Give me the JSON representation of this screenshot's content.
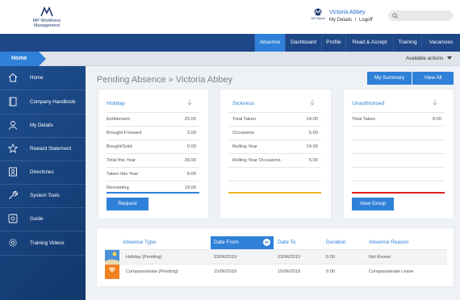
{
  "brand": {
    "logo_text_line1": "MP Workforce",
    "logo_text_line2": "Management",
    "user_logo_text": "MP Payroll"
  },
  "user": {
    "name": "Victoria Abbey",
    "my_details": "My Details",
    "separator": "/",
    "logoff": "Logoff"
  },
  "search": {
    "placeholder": ""
  },
  "nav": {
    "items": [
      "Absence",
      "Dashboard",
      "Profile",
      "Read & Accept",
      "Training",
      "Vacancies"
    ],
    "active": "Absence"
  },
  "subbar": {
    "home": "Home",
    "available_actions": "Available actions"
  },
  "sidebar": {
    "items": [
      {
        "label": "Home",
        "icon": "home-icon"
      },
      {
        "label": "Company Handbook",
        "icon": "book-icon"
      },
      {
        "label": "My Details",
        "icon": "user-icon"
      },
      {
        "label": "Reward Statement",
        "icon": "star-icon"
      },
      {
        "label": "Directories",
        "icon": "directory-icon"
      },
      {
        "label": "System Tools",
        "icon": "wrench-icon"
      },
      {
        "label": "Guide",
        "icon": "guide-icon"
      },
      {
        "label": "Training Videos",
        "icon": "gear-icon"
      }
    ]
  },
  "main": {
    "title": "Pending Absence » Victoria Abbey",
    "my_summary": "My Summary",
    "view_all": "View All"
  },
  "cards": {
    "holiday": {
      "title": "Holiday",
      "rows": [
        {
          "label": "Entitlement",
          "value": "25.00"
        },
        {
          "label": "Brought Forward",
          "value": "3.00"
        },
        {
          "label": "Bought/Sold",
          "value": "0.00"
        },
        {
          "label": "Total this Year",
          "value": "28.00"
        },
        {
          "label": "Taken this Year",
          "value": "9.00"
        },
        {
          "label": "Remaining",
          "value": "19.00"
        }
      ],
      "bar_color": "#2f80d8",
      "button": "Request"
    },
    "sickness": {
      "title": "Sickness",
      "rows": [
        {
          "label": "Total Taken",
          "value": "14.00"
        },
        {
          "label": "Occasions",
          "value": "5.00"
        },
        {
          "label": "Rolling Year",
          "value": "14.00"
        },
        {
          "label": "Rolling Year Occasions",
          "value": "5.00"
        }
      ],
      "bar_color": "#f0b429"
    },
    "unauthorised": {
      "title": "Unauthorised",
      "rows": [
        {
          "label": "Total Taken",
          "value": "0.00"
        }
      ],
      "bar_color": "#e02020",
      "button": "View Group"
    }
  },
  "table": {
    "headers": [
      "Absence Type",
      "Date From",
      "Date To",
      "Duration",
      "Absence Reason"
    ],
    "sorted_column": "Date From",
    "rows": [
      {
        "type": "Holiday (Pending)",
        "date_from": "23/06/2019",
        "date_to": "23/06/2019",
        "duration": "0.00",
        "reason": "Not Known",
        "color": "#4a90d9"
      },
      {
        "type": "Compassionate (Pending)",
        "date_from": "15/06/2019",
        "date_to": "15/06/2019",
        "duration": "0.00",
        "reason": "Compassionate Leave",
        "color": "#f08020"
      }
    ]
  }
}
